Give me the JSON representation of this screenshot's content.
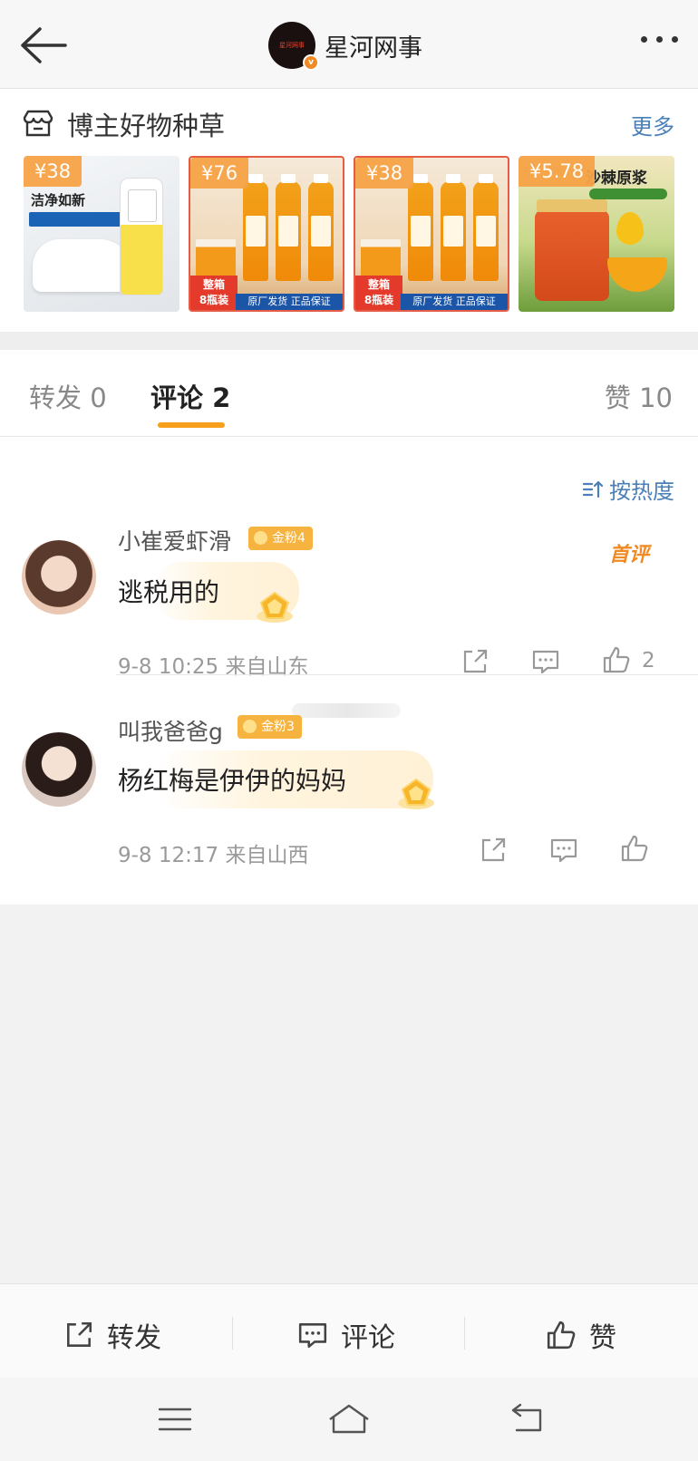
{
  "header": {
    "account_name": "星河网事",
    "avatar_logo_text": "星河网事"
  },
  "shop": {
    "title": "博主好物种草",
    "more_label": "更多",
    "products": [
      {
        "price": "¥38",
        "headline": "洁净如新"
      },
      {
        "price": "¥76",
        "tag": "整箱\n8瓶装",
        "strip": "原厂发货 正品保证"
      },
      {
        "price": "¥38",
        "tag": "整箱\n8瓶装",
        "strip": "原厂发货 正品保证"
      },
      {
        "price": "¥5.78",
        "headline": "沙棘原浆"
      }
    ]
  },
  "tabs": {
    "repost": "转发 0",
    "comment": "评论 2",
    "like": "赞 10"
  },
  "sort_label": "按热度",
  "comments": [
    {
      "username": "小崔爱虾滑",
      "fan_badge": "金粉4",
      "first_badge": "首评",
      "text": "逃税用的",
      "meta": "9-8 10:25 来自山东",
      "likes": "2"
    },
    {
      "username": "叫我爸爸g",
      "fan_badge": "金粉3",
      "text": "杨红梅是伊伊的妈妈",
      "meta": "9-8 12:17 来自山西"
    }
  ],
  "action_bar": {
    "repost": "转发",
    "comment": "评论",
    "like": "赞"
  },
  "icons": [
    "back-arrow-icon",
    "more-icon",
    "shop-icon",
    "sort-icon",
    "share-icon",
    "comment-icon",
    "like-icon",
    "menu-icon",
    "home-icon",
    "back-nav-icon"
  ],
  "colors": {
    "accent": "#f79f1c",
    "link": "#4a7fb8",
    "badge": "#f6b340"
  }
}
